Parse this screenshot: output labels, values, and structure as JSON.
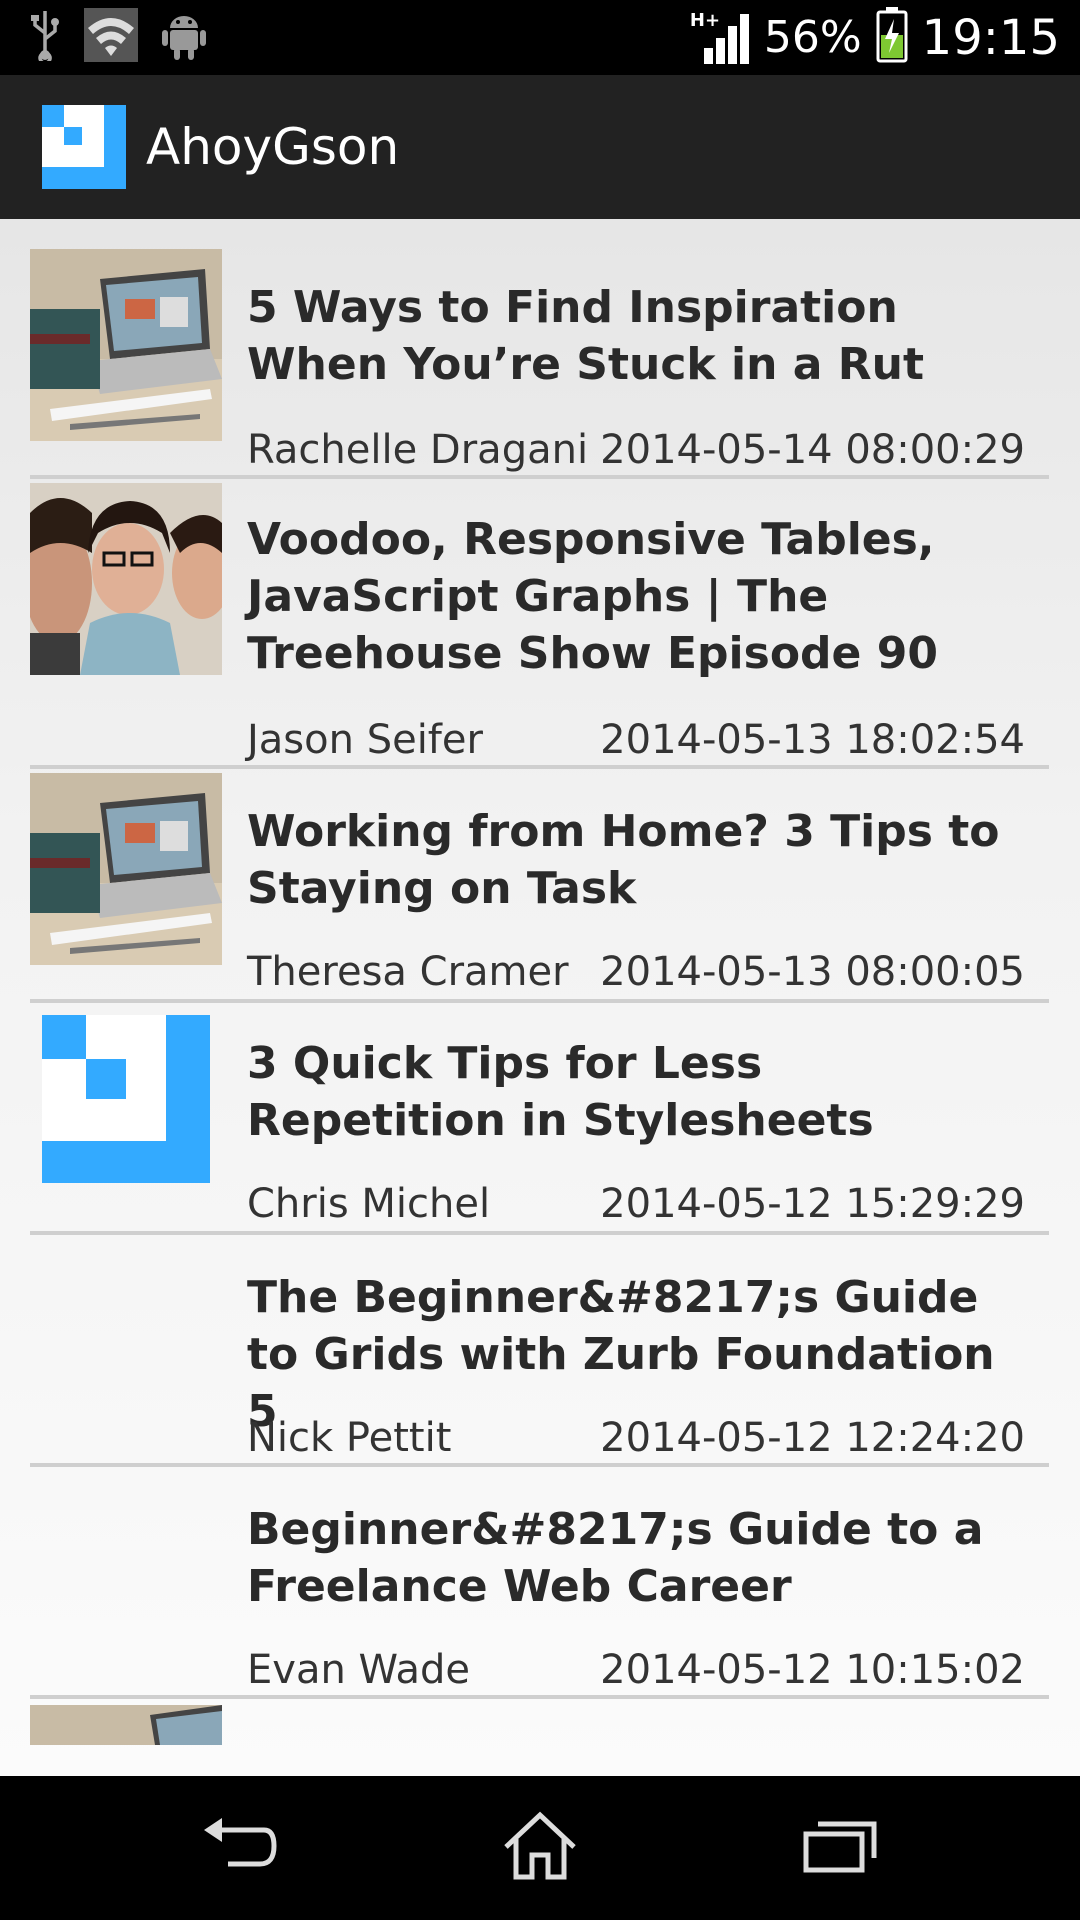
{
  "status_bar": {
    "icons_left": [
      "usb-icon",
      "wifi-icon",
      "android-icon"
    ],
    "network_type": "H+",
    "battery_percent": "56%",
    "time": "19:15"
  },
  "action_bar": {
    "app_name": "AhoyGson",
    "logo_color": "#33aaff"
  },
  "articles": [
    {
      "title": "5 Ways to Find Inspiration When You’re Stuck in a Rut",
      "author": "Rachelle Dragani",
      "date": "2014-05-14 08:00:29",
      "thumbnail": "laptop-photo"
    },
    {
      "title": "Voodoo, Responsive Tables, JavaScript Graphs | The Treehouse Show Episode 90",
      "author": "Jason Seifer",
      "date": "2014-05-13 18:02:54",
      "thumbnail": "people-photo"
    },
    {
      "title": "Working from Home? 3 Tips to Staying on Task",
      "author": "Theresa Cramer",
      "date": "2014-05-13 08:00:05",
      "thumbnail": "laptop-photo"
    },
    {
      "title": "3 Quick Tips for Less Repetition in Stylesheets",
      "author": "Chris Michel",
      "date": "2014-05-12 15:29:29",
      "thumbnail": "app-logo"
    },
    {
      "title": "The Beginner&#8217;s Guide to Grids with Zurb Foundation 5",
      "author": "Nick Pettit",
      "date": "2014-05-12 12:24:20",
      "thumbnail": "none"
    },
    {
      "title": "Beginner&#8217;s Guide to a Freelance Web Career",
      "author": "Evan Wade",
      "date": "2014-05-12 10:15:02",
      "thumbnail": "none"
    }
  ],
  "nav_bar": {
    "buttons": [
      "back-icon",
      "home-icon",
      "recent-apps-icon"
    ]
  }
}
